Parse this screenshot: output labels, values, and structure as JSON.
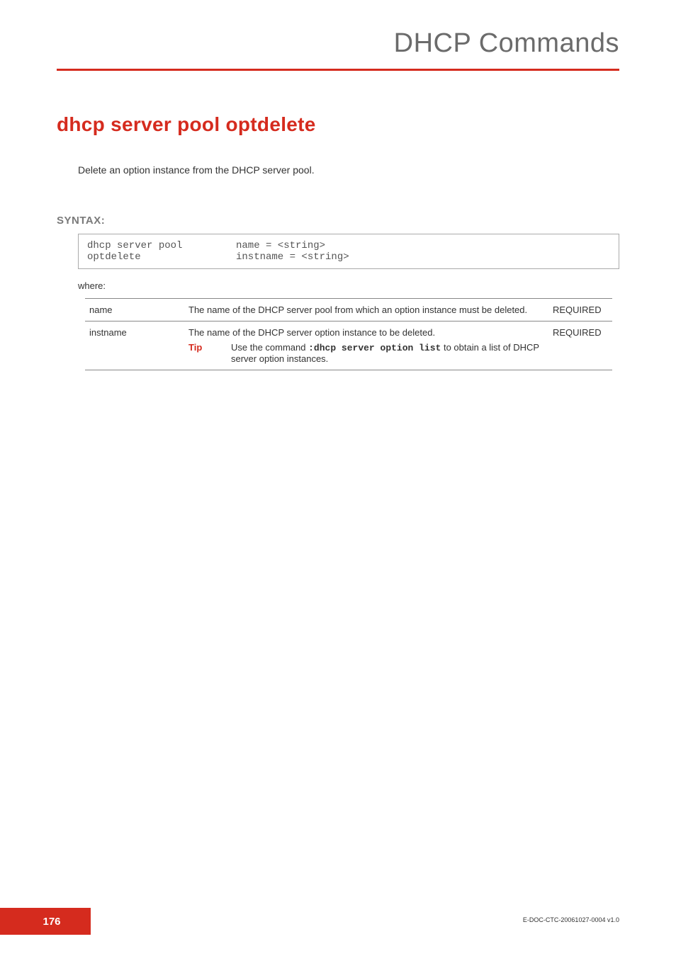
{
  "header": {
    "chapter_title": "DHCP Commands"
  },
  "command": {
    "title": "dhcp server pool optdelete",
    "description": "Delete an option instance from the DHCP server pool."
  },
  "syntax": {
    "label": "SYNTAX:",
    "command_text": "dhcp server pool optdelete",
    "args_text": "name = <string>\ninstname = <string>",
    "where_label": "where:"
  },
  "params": [
    {
      "name": "name",
      "description": "The name of the DHCP server pool from which an option instance must be deleted.",
      "requirement": "REQUIRED"
    },
    {
      "name": "instname",
      "description": "The name of the DHCP server option instance to be deleted.",
      "requirement": "REQUIRED",
      "tip_label": "Tip",
      "tip_pre": "Use the command ",
      "tip_code": ":dhcp server option list",
      "tip_post": " to obtain a list of DHCP server option instances."
    }
  ],
  "footer": {
    "page_number": "176",
    "doc_id": "E-DOC-CTC-20061027-0004 v1.0"
  }
}
